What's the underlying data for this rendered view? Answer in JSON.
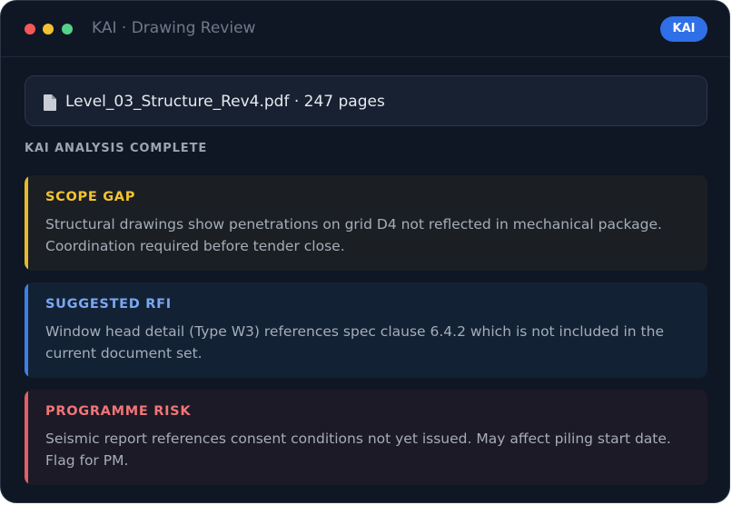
{
  "window": {
    "title": "KAI · Drawing Review",
    "badge": "KAI"
  },
  "file": {
    "icon": "file-icon",
    "label": "Level_03_Structure_Rev4.pdf · 247 pages"
  },
  "analysis": {
    "status_label": "KAI ANALYSIS COMPLETE",
    "cards": [
      {
        "title": "SCOPE GAP",
        "body": "Structural drawings show penetrations on grid D4 not reflected in mechanical package. Coordination required before tender close.",
        "accent": "#e7b92c"
      },
      {
        "title": "SUGGESTED RFI",
        "body": "Window head detail (Type W3) references spec clause 6.4.2 which is not included in the current document set.",
        "accent": "#3f7fe6"
      },
      {
        "title": "PROGRAMME RISK",
        "body": "Seismic report references consent conditions not yet issued. May affect piling start date. Flag for PM.",
        "accent": "#e25f63"
      }
    ]
  },
  "colors": {
    "window_bg": "#0f1724",
    "badge_bg": "#2f6fe8"
  }
}
